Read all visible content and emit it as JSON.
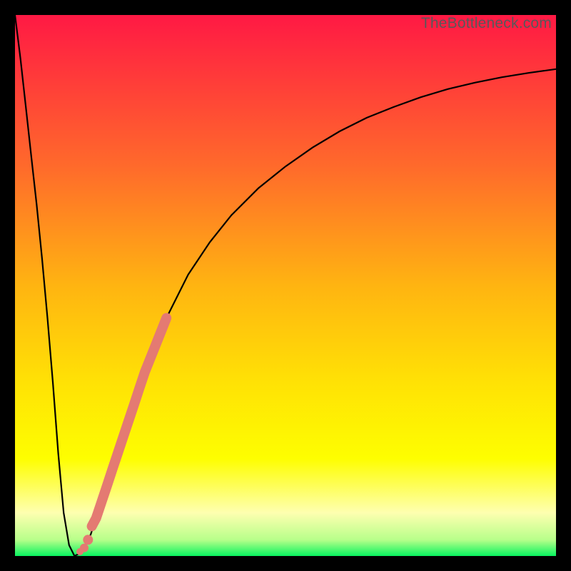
{
  "watermark": "TheBottleneck.com",
  "colors": {
    "frame": "#000000",
    "curve": "#000000",
    "dots": "#e47a72",
    "grad_top": "#ff1944",
    "grad_mid_upper": "#ff6a2b",
    "grad_mid": "#ffb411",
    "grad_mid_lower": "#ffe205",
    "grad_yellow": "#fefe00",
    "grad_lightyellow": "#feffb0",
    "grad_green": "#08f45f"
  },
  "chart_data": {
    "type": "line",
    "title": "",
    "xlabel": "",
    "ylabel": "",
    "xlim": [
      0,
      100
    ],
    "ylim": [
      0,
      100
    ],
    "series": [
      {
        "name": "bottleneck-curve",
        "x": [
          0,
          1,
          2,
          3,
          4,
          5,
          6,
          7,
          8,
          9,
          10,
          11,
          12,
          13,
          14,
          15,
          17,
          20,
          24,
          28,
          32,
          36,
          40,
          45,
          50,
          55,
          60,
          65,
          70,
          75,
          80,
          85,
          90,
          95,
          100
        ],
        "y": [
          100,
          92,
          83,
          74,
          65,
          55,
          44,
          32,
          19,
          8,
          2,
          0,
          0.5,
          2,
          4,
          7,
          13,
          22,
          34,
          44,
          52,
          58,
          63,
          68,
          72,
          75.5,
          78.5,
          81,
          83,
          84.8,
          86.3,
          87.5,
          88.5,
          89.3,
          90
        ]
      }
    ],
    "highlight_points": {
      "name": "highlighted-range",
      "x": [
        14.2,
        15.0,
        16.0,
        17.0,
        18.0,
        19.0,
        20.0,
        21.0,
        22.0,
        23.0,
        24.0,
        25.0,
        26.0,
        27.0,
        28.0
      ],
      "y": [
        5.5,
        7.0,
        10.0,
        13.0,
        16.0,
        19.0,
        22.0,
        25.0,
        28.0,
        31.0,
        34.0,
        36.5,
        39.0,
        41.5,
        44.0
      ]
    },
    "extra_dots": {
      "name": "near-minimum",
      "x": [
        12.0,
        12.8,
        13.5
      ],
      "y": [
        0.8,
        1.5,
        3.0
      ]
    }
  }
}
